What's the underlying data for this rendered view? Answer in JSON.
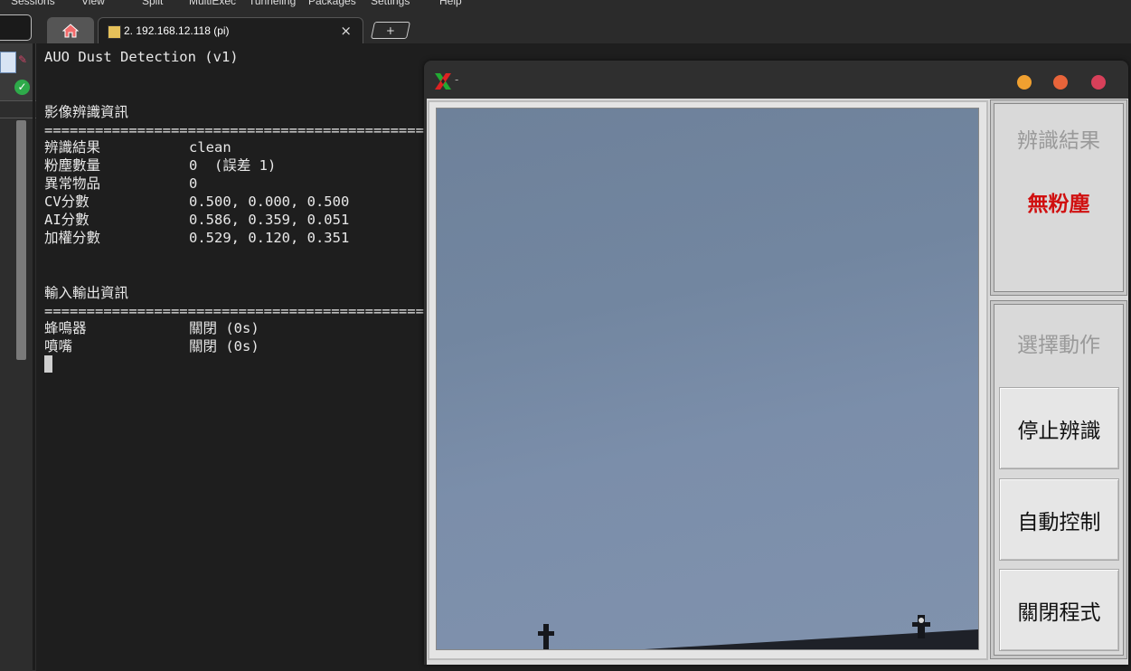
{
  "menu": {
    "items": [
      "Sessions",
      "View",
      "Split",
      "MultiExec",
      "Tunneling",
      "Packages",
      "Settings",
      "Help"
    ]
  },
  "tabs": {
    "home_icon": "home-icon",
    "session_label": "2. 192.168.12.118 (pi)",
    "close_glyph": "×",
    "new_tab_glyph": "+"
  },
  "terminal": {
    "title": "AUO Dust Detection (v1)",
    "section1": {
      "heading": "影像辨識資訊",
      "separator": "=========================================================================================",
      "rows": [
        {
          "label": "辨識結果",
          "value": "clean"
        },
        {
          "label": "粉塵數量",
          "value": "0  (誤差 1)"
        },
        {
          "label": "異常物品",
          "value": "0"
        },
        {
          "label": "CV分數",
          "value": "0.500, 0.000, 0.500"
        },
        {
          "label": "AI分數",
          "value": "0.586, 0.359, 0.051"
        },
        {
          "label": "加權分數",
          "value": "0.529, 0.120, 0.351"
        }
      ]
    },
    "section2": {
      "heading": "輸入輸出資訊",
      "separator": "=========================================================================================",
      "rows": [
        {
          "label": "蜂鳴器",
          "value": "關閉 (0s)"
        },
        {
          "label": "噴嘴",
          "value": "關閉 (0s)"
        }
      ]
    }
  },
  "app": {
    "title": "-",
    "result": {
      "heading": "辨識結果",
      "value": "無粉塵",
      "value_color": "#d01010"
    },
    "actions": {
      "heading": "選擇動作",
      "buttons": [
        "停止辨識",
        "自動控制",
        "關閉程式"
      ]
    }
  },
  "colors": {
    "terminal_bg": "#1e1e1e",
    "window_btn_min": "#f0a030",
    "window_btn_max": "#e8643a",
    "window_btn_close": "#d8405a"
  }
}
